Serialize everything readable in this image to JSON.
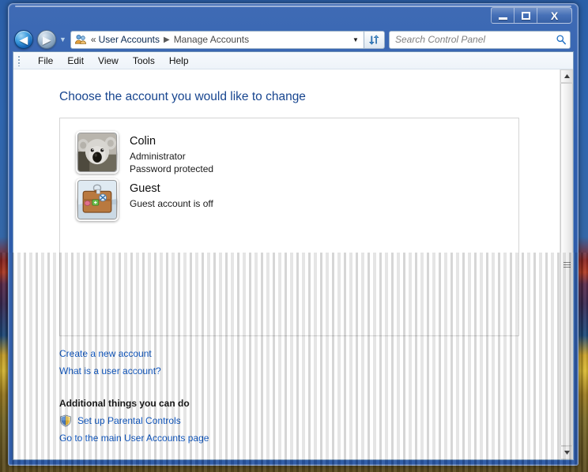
{
  "window": {
    "controls": {
      "minimize_label": "Minimize",
      "maximize_label": "Maximize",
      "close_label": "X"
    }
  },
  "navigation": {
    "back_label": "◀",
    "forward_label": "▶",
    "recent_pages_label": "▼",
    "breadcrumb_prefix": "«",
    "crumbs": [
      {
        "label": "User Accounts"
      },
      {
        "label": "Manage Accounts"
      }
    ],
    "separator": "▶",
    "dropdown_label": "▼",
    "refresh_label": "Refresh",
    "address_icon": "user-accounts-icon"
  },
  "search": {
    "placeholder": "Search Control Panel",
    "value": "",
    "icon": "search-icon"
  },
  "menubar": {
    "items": [
      {
        "label": "File"
      },
      {
        "label": "Edit"
      },
      {
        "label": "View"
      },
      {
        "label": "Tools"
      },
      {
        "label": "Help"
      }
    ]
  },
  "main": {
    "page_title": "Choose the account you would like to change",
    "accounts": [
      {
        "name": "Colin",
        "line1": "Administrator",
        "line2": "Password protected",
        "avatar": "koala-photo-avatar"
      },
      {
        "name": "Guest",
        "line1": "Guest account is off",
        "line2": "",
        "avatar": "suitcase-avatar"
      }
    ],
    "links": [
      {
        "label": "Create a new account"
      },
      {
        "label": "What is a user account?"
      }
    ],
    "additional_heading": "Additional things you can do",
    "additional_links": [
      {
        "label": "Set up Parental Controls",
        "icon": "uac-shield-icon"
      },
      {
        "label": "Go to the main User Accounts page",
        "icon": ""
      }
    ]
  },
  "scrollbar": {
    "up_label": "▲",
    "down_label": "▼"
  },
  "colors": {
    "title_blue": "#17458f",
    "link_blue": "#0b55c2",
    "frame_blue": "#2f5fae"
  }
}
